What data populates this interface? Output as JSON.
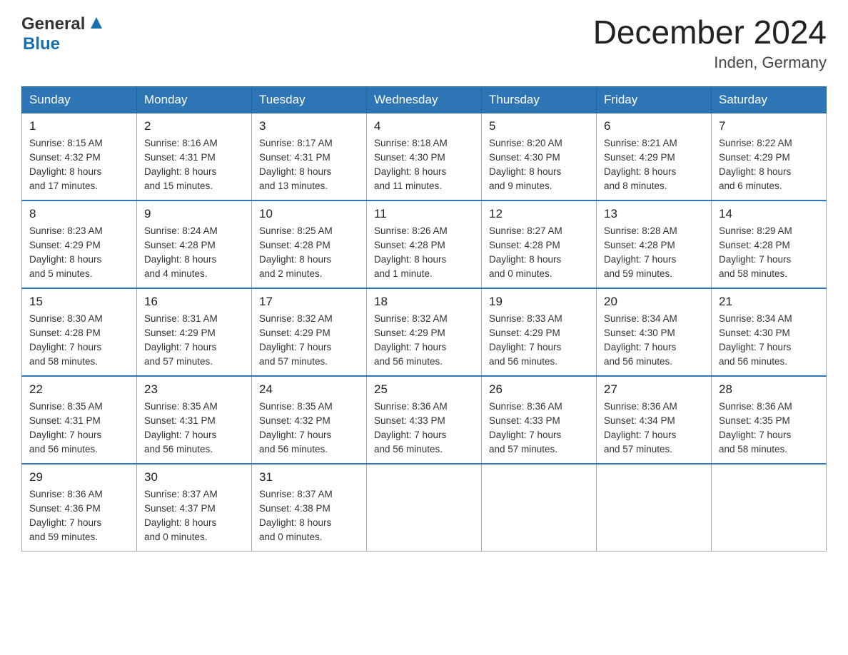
{
  "header": {
    "logo_general": "General",
    "logo_blue": "Blue",
    "month_year": "December 2024",
    "location": "Inden, Germany"
  },
  "weekdays": [
    "Sunday",
    "Monday",
    "Tuesday",
    "Wednesday",
    "Thursday",
    "Friday",
    "Saturday"
  ],
  "weeks": [
    [
      {
        "day": "1",
        "sunrise": "8:15 AM",
        "sunset": "4:32 PM",
        "daylight": "8 hours and 17 minutes."
      },
      {
        "day": "2",
        "sunrise": "8:16 AM",
        "sunset": "4:31 PM",
        "daylight": "8 hours and 15 minutes."
      },
      {
        "day": "3",
        "sunrise": "8:17 AM",
        "sunset": "4:31 PM",
        "daylight": "8 hours and 13 minutes."
      },
      {
        "day": "4",
        "sunrise": "8:18 AM",
        "sunset": "4:30 PM",
        "daylight": "8 hours and 11 minutes."
      },
      {
        "day": "5",
        "sunrise": "8:20 AM",
        "sunset": "4:30 PM",
        "daylight": "8 hours and 9 minutes."
      },
      {
        "day": "6",
        "sunrise": "8:21 AM",
        "sunset": "4:29 PM",
        "daylight": "8 hours and 8 minutes."
      },
      {
        "day": "7",
        "sunrise": "8:22 AM",
        "sunset": "4:29 PM",
        "daylight": "8 hours and 6 minutes."
      }
    ],
    [
      {
        "day": "8",
        "sunrise": "8:23 AM",
        "sunset": "4:29 PM",
        "daylight": "8 hours and 5 minutes."
      },
      {
        "day": "9",
        "sunrise": "8:24 AM",
        "sunset": "4:28 PM",
        "daylight": "8 hours and 4 minutes."
      },
      {
        "day": "10",
        "sunrise": "8:25 AM",
        "sunset": "4:28 PM",
        "daylight": "8 hours and 2 minutes."
      },
      {
        "day": "11",
        "sunrise": "8:26 AM",
        "sunset": "4:28 PM",
        "daylight": "8 hours and 1 minute."
      },
      {
        "day": "12",
        "sunrise": "8:27 AM",
        "sunset": "4:28 PM",
        "daylight": "8 hours and 0 minutes."
      },
      {
        "day": "13",
        "sunrise": "8:28 AM",
        "sunset": "4:28 PM",
        "daylight": "7 hours and 59 minutes."
      },
      {
        "day": "14",
        "sunrise": "8:29 AM",
        "sunset": "4:28 PM",
        "daylight": "7 hours and 58 minutes."
      }
    ],
    [
      {
        "day": "15",
        "sunrise": "8:30 AM",
        "sunset": "4:28 PM",
        "daylight": "7 hours and 58 minutes."
      },
      {
        "day": "16",
        "sunrise": "8:31 AM",
        "sunset": "4:29 PM",
        "daylight": "7 hours and 57 minutes."
      },
      {
        "day": "17",
        "sunrise": "8:32 AM",
        "sunset": "4:29 PM",
        "daylight": "7 hours and 57 minutes."
      },
      {
        "day": "18",
        "sunrise": "8:32 AM",
        "sunset": "4:29 PM",
        "daylight": "7 hours and 56 minutes."
      },
      {
        "day": "19",
        "sunrise": "8:33 AM",
        "sunset": "4:29 PM",
        "daylight": "7 hours and 56 minutes."
      },
      {
        "day": "20",
        "sunrise": "8:34 AM",
        "sunset": "4:30 PM",
        "daylight": "7 hours and 56 minutes."
      },
      {
        "day": "21",
        "sunrise": "8:34 AM",
        "sunset": "4:30 PM",
        "daylight": "7 hours and 56 minutes."
      }
    ],
    [
      {
        "day": "22",
        "sunrise": "8:35 AM",
        "sunset": "4:31 PM",
        "daylight": "7 hours and 56 minutes."
      },
      {
        "day": "23",
        "sunrise": "8:35 AM",
        "sunset": "4:31 PM",
        "daylight": "7 hours and 56 minutes."
      },
      {
        "day": "24",
        "sunrise": "8:35 AM",
        "sunset": "4:32 PM",
        "daylight": "7 hours and 56 minutes."
      },
      {
        "day": "25",
        "sunrise": "8:36 AM",
        "sunset": "4:33 PM",
        "daylight": "7 hours and 56 minutes."
      },
      {
        "day": "26",
        "sunrise": "8:36 AM",
        "sunset": "4:33 PM",
        "daylight": "7 hours and 57 minutes."
      },
      {
        "day": "27",
        "sunrise": "8:36 AM",
        "sunset": "4:34 PM",
        "daylight": "7 hours and 57 minutes."
      },
      {
        "day": "28",
        "sunrise": "8:36 AM",
        "sunset": "4:35 PM",
        "daylight": "7 hours and 58 minutes."
      }
    ],
    [
      {
        "day": "29",
        "sunrise": "8:36 AM",
        "sunset": "4:36 PM",
        "daylight": "7 hours and 59 minutes."
      },
      {
        "day": "30",
        "sunrise": "8:37 AM",
        "sunset": "4:37 PM",
        "daylight": "8 hours and 0 minutes."
      },
      {
        "day": "31",
        "sunrise": "8:37 AM",
        "sunset": "4:38 PM",
        "daylight": "8 hours and 0 minutes."
      },
      null,
      null,
      null,
      null
    ]
  ],
  "labels": {
    "sunrise": "Sunrise:",
    "sunset": "Sunset:",
    "daylight": "Daylight:"
  }
}
